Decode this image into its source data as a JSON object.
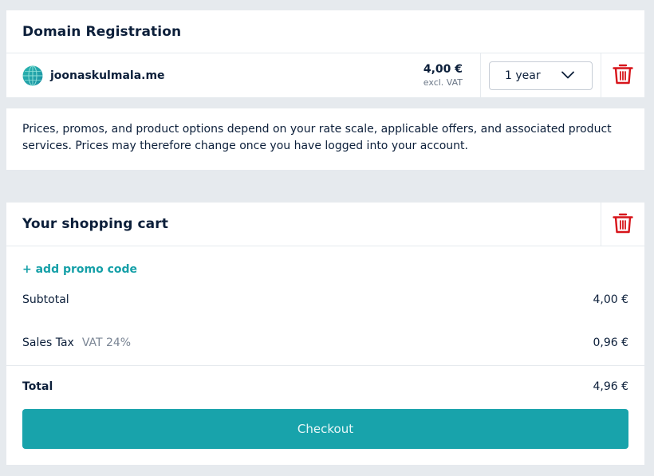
{
  "domain_section": {
    "title": "Domain Registration",
    "domain_name": "joonaskulmala.me",
    "price": "4,00 €",
    "price_note": "excl. VAT",
    "period": "1 year"
  },
  "info": {
    "text": "Prices, promos, and product options depend on your rate scale, applicable offers, and associated product services. Prices may therefore change once you have logged into your account."
  },
  "cart": {
    "title": "Your shopping cart",
    "promo_link": "+ add promo code",
    "subtotal_label": "Subtotal",
    "subtotal_value": "4,00 €",
    "tax_label": "Sales Tax",
    "tax_note": "VAT 24%",
    "tax_value": "0,96 €",
    "total_label": "Total",
    "total_value": "4,96 €",
    "checkout_label": "Checkout"
  },
  "icons": {
    "globe": "globe-icon",
    "dropdown": "chevron-down-icon",
    "delete": "trash-icon"
  },
  "colors": {
    "accent": "#18a3ab",
    "delete": "#d7141a",
    "text": "#0c1f3a",
    "background": "#e6eaee"
  }
}
